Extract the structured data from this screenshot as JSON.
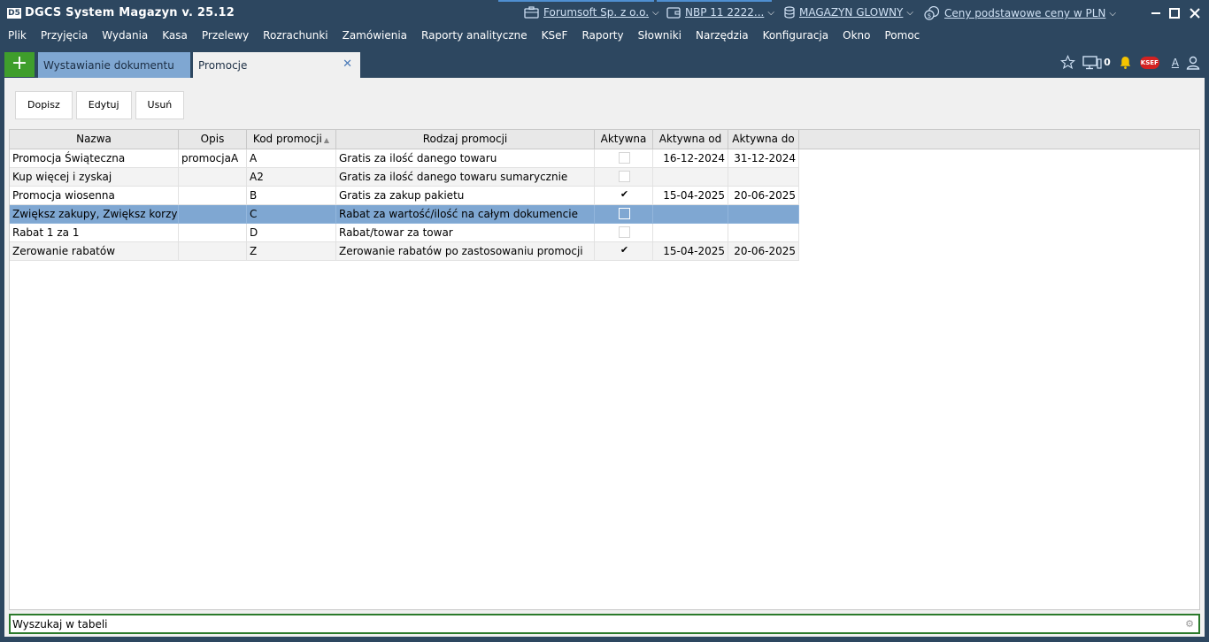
{
  "app": {
    "logo_text": "D5",
    "title": "DGCS System Magazyn v. 25.12",
    "context": {
      "company": "Forumsoft Sp. z o.o.",
      "rate": "NBP 11 2222...",
      "warehouse": "MAGAZYN GLOWNY",
      "prices": "Ceny podstawowe ceny w PLN"
    }
  },
  "menu": [
    "Plik",
    "Przyjęcia",
    "Wydania",
    "Kasa",
    "Przelewy",
    "Rozrachunki",
    "Zamówienia",
    "Raporty analityczne",
    "KSeF",
    "Raporty",
    "Słowniki",
    "Narzędzia",
    "Konfiguracja",
    "Okno",
    "Pomoc"
  ],
  "tabs": {
    "add_label": "+",
    "items": [
      {
        "label": "Wystawianie dokumentu"
      },
      {
        "label": "Promocje",
        "close": "✕"
      }
    ]
  },
  "header_icons": {
    "screen_count": "0",
    "ksef_badge": "KSEF",
    "font_size_label": "A",
    "icon_names": [
      "star-icon",
      "monitor-icon",
      "bell-icon",
      "ksef-icon",
      "font-size-icon",
      "user-icon"
    ],
    "colors": {
      "bell": "#f5c400",
      "ksef": "#d32222"
    }
  },
  "toolbar": {
    "add_label": "Dopisz",
    "edit_label": "Edytuj",
    "delete_label": "Usuń"
  },
  "table": {
    "columns": [
      "Nazwa",
      "Opis",
      "Kod promocji",
      "Rodzaj promocji",
      "Aktywna",
      "Aktywna od",
      "Aktywna do"
    ],
    "sort_indicator": "▲",
    "rows": [
      {
        "nazwa": "Promocja Świąteczna",
        "opis": "promocjaA",
        "kod": "A",
        "rodzaj": "Gratis za ilość danego towaru",
        "aktywna": false,
        "od": "16-12-2024",
        "do": "31-12-2024"
      },
      {
        "nazwa": "Kup więcej i zyskaj",
        "opis": "",
        "kod": "A2",
        "rodzaj": "Gratis za ilość danego towaru sumarycznie",
        "aktywna": false,
        "od": "",
        "do": ""
      },
      {
        "nazwa": "Promocja wiosenna",
        "opis": "",
        "kod": "B",
        "rodzaj": "Gratis za zakup pakietu",
        "aktywna": true,
        "od": "15-04-2025",
        "do": "20-06-2025"
      },
      {
        "nazwa": "Zwiększ zakupy, Zwiększ korzyści",
        "opis": "",
        "kod": "C",
        "rodzaj": "Rabat za wartość/ilość na całym dokumencie",
        "aktywna": false,
        "od": "",
        "do": "",
        "selected": true
      },
      {
        "nazwa": "Rabat 1 za 1",
        "opis": "",
        "kod": "D",
        "rodzaj": "Rabat/towar za towar",
        "aktywna": false,
        "od": "",
        "do": ""
      },
      {
        "nazwa": "Zerowanie rabatów",
        "opis": "",
        "kod": "Z",
        "rodzaj": "Zerowanie rabatów po zastosowaniu promocji",
        "aktywna": true,
        "od": "15-04-2025",
        "do": "20-06-2025"
      }
    ],
    "check_glyph": "✔"
  },
  "search": {
    "placeholder": "Wyszukaj w tabeli",
    "gear_glyph": "⚙"
  },
  "colors": {
    "titlebar_bg": "#2d4760",
    "accent_green": "#3f9e2c",
    "selected_row": "#7fa7d2",
    "inactive_tab": "#7fa7d2"
  }
}
